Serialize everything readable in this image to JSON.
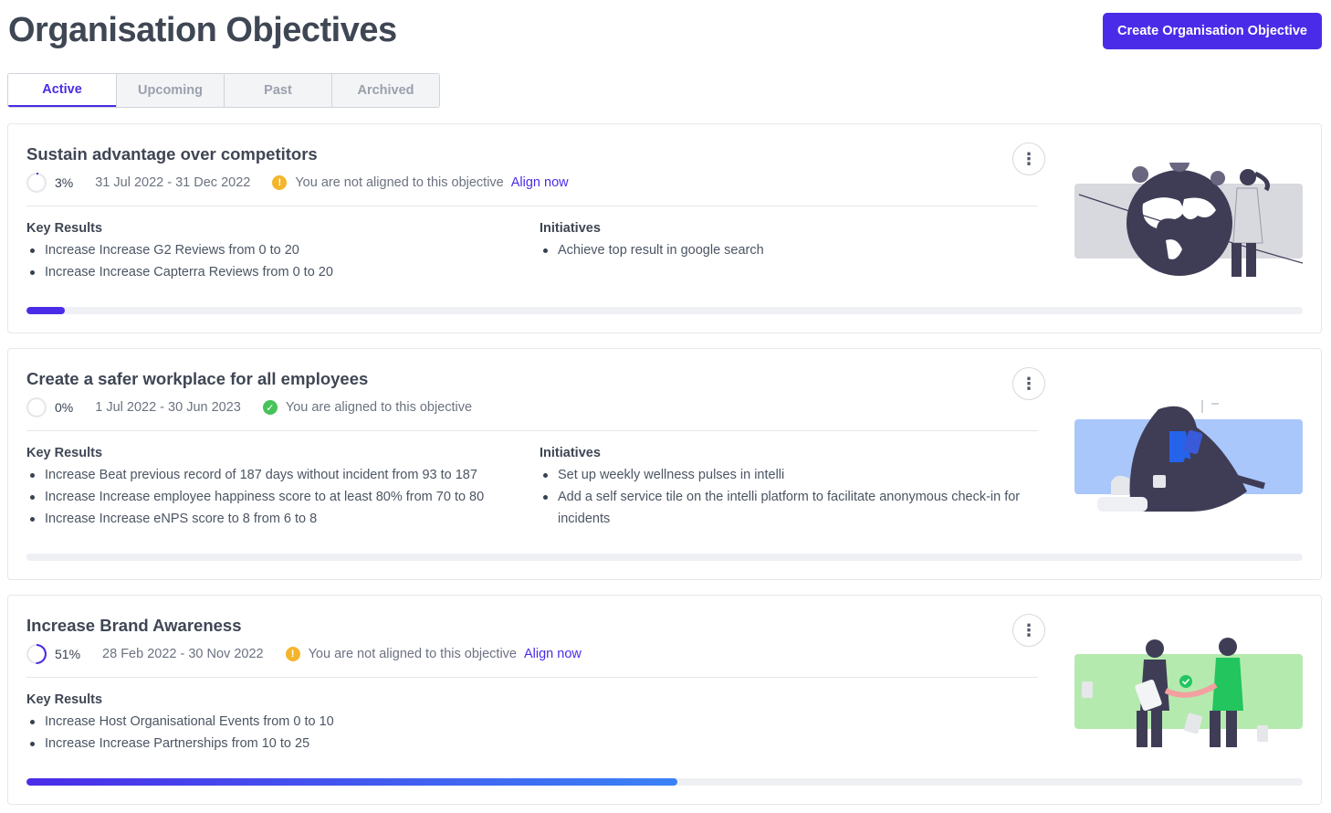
{
  "page": {
    "title": "Organisation Objectives",
    "create_button": "Create Organisation Objective",
    "accent_color": "#4a2ce8"
  },
  "tabs": [
    {
      "label": "Active",
      "active": true
    },
    {
      "label": "Upcoming",
      "active": false
    },
    {
      "label": "Past",
      "active": false
    },
    {
      "label": "Archived",
      "active": false
    }
  ],
  "objectives": [
    {
      "title": "Sustain advantage over competitors",
      "progress_percent": 3,
      "progress_label": "3%",
      "dates": "31 Jul 2022 - 31 Dec 2022",
      "status": "You are not aligned to this objective",
      "status_type": "warning",
      "align_link": "Align now",
      "key_results_heading": "Key Results",
      "key_results": [
        "Increase Increase G2 Reviews from 0 to 20",
        "Increase Increase Capterra Reviews from 0 to 20"
      ],
      "initiatives_heading": "Initiatives",
      "initiatives": [
        "Achieve top result in google search"
      ],
      "illustration": "globe-map-illustration"
    },
    {
      "title": "Create a safer workplace for all employees",
      "progress_percent": 0,
      "progress_label": "0%",
      "dates": "1 Jul 2022 - 30 Jun 2023",
      "status": "You are aligned to this objective",
      "status_type": "success",
      "align_link": "",
      "key_results_heading": "Key Results",
      "key_results": [
        "Increase Beat previous record of 187 days without incident from 93 to 187",
        "Increase Increase employee happiness score to at least 80% from 70 to 80",
        "Increase Increase eNPS score to 8 from 6 to 8"
      ],
      "initiatives_heading": "Initiatives",
      "initiatives": [
        "Set up weekly wellness pulses in intelli",
        "Add a self service tile on the intelli platform to facilitate anonymous check-in for incidents"
      ],
      "illustration": "person-relaxing-illustration"
    },
    {
      "title": "Increase Brand Awareness",
      "progress_percent": 51,
      "progress_label": "51%",
      "dates": "28 Feb 2022 - 30 Nov 2022",
      "status": "You are not aligned to this objective",
      "status_type": "warning",
      "align_link": "Align now",
      "key_results_heading": "Key Results",
      "key_results": [
        "Increase Host Organisational Events from 0 to 10",
        "Increase Increase Partnerships from 10 to 25"
      ],
      "illustration": "handshake-illustration"
    }
  ]
}
